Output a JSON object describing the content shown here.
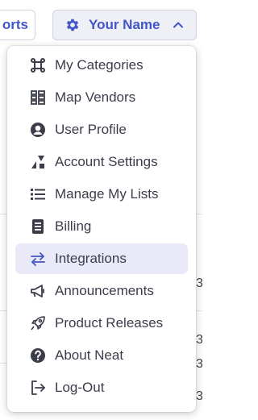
{
  "header": {
    "reports_label": "orts",
    "user_name": "Your Name"
  },
  "menu": {
    "items": [
      {
        "label": "My Categories",
        "icon": "command-icon"
      },
      {
        "label": "Map Vendors",
        "icon": "grid-list-icon"
      },
      {
        "label": "User Profile",
        "icon": "user-circle-icon"
      },
      {
        "label": "Account Settings",
        "icon": "shapes-icon"
      },
      {
        "label": "Manage My Lists",
        "icon": "list-icon"
      },
      {
        "label": "Billing",
        "icon": "receipt-icon"
      },
      {
        "label": "Integrations",
        "icon": "arrows-swap-icon",
        "active": true
      },
      {
        "label": "Announcements",
        "icon": "megaphone-icon"
      },
      {
        "label": "Product Releases",
        "icon": "rocket-icon"
      },
      {
        "label": "About Neat",
        "icon": "question-circle-icon"
      },
      {
        "label": "Log-Out",
        "icon": "logout-icon"
      }
    ]
  },
  "colors": {
    "accent": "#4256c7",
    "active_bg": "#e9e9f7",
    "icon": "#3b3d4a"
  },
  "background_digits": [
    "3",
    "3",
    "3",
    "3"
  ]
}
